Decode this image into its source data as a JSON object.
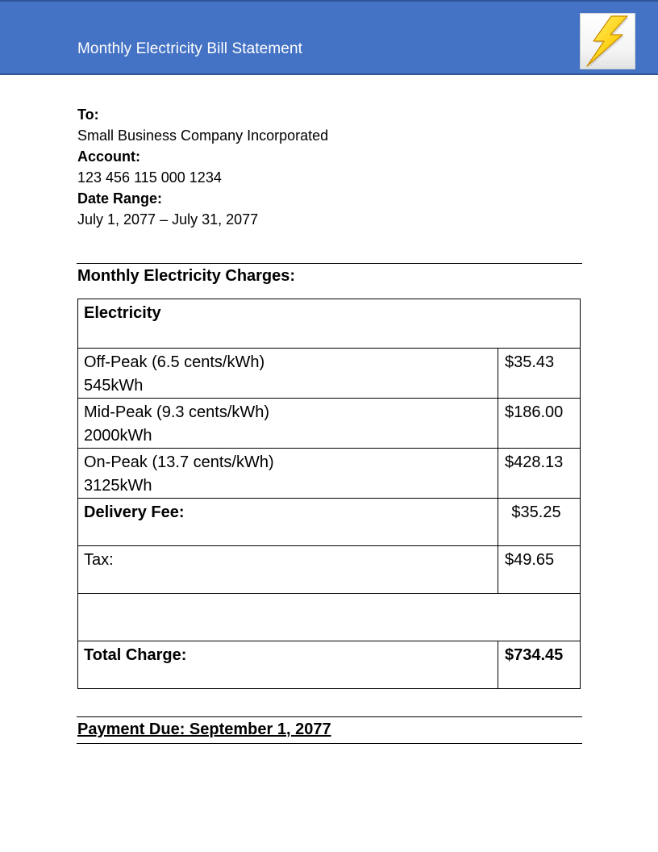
{
  "header": {
    "title": "Monthly Electricity Bill Statement",
    "logo_icon": "lightning-bolt-icon",
    "background_color": "#4472c4"
  },
  "recipient": {
    "to_label": "To:",
    "to_value": "Small Business Company Incorporated",
    "account_label": "Account:",
    "account_value": "123 456 115 000 1234",
    "date_range_label": "Date Range:",
    "date_range_value": "July 1, 2077 – July 31, 2077"
  },
  "charges": {
    "heading": "Monthly Electricity Charges:",
    "section_title": "Electricity",
    "rows": [
      {
        "label": "Off-Peak (6.5 cents/kWh)",
        "usage": "545kWh",
        "amount": "$35.43"
      },
      {
        "label": "Mid-Peak (9.3 cents/kWh)",
        "usage": "2000kWh",
        "amount": "$186.00"
      },
      {
        "label": "On-Peak (13.7 cents/kWh)",
        "usage": "3125kWh",
        "amount": "$428.13"
      }
    ],
    "delivery_fee_label": "Delivery Fee:",
    "delivery_fee_amount": "$35.25",
    "tax_label": "Tax:",
    "tax_amount": "$49.65",
    "total_label": "Total Charge:",
    "total_amount": "$734.45"
  },
  "payment": {
    "due_text": "Payment Due: September 1, 2077"
  }
}
